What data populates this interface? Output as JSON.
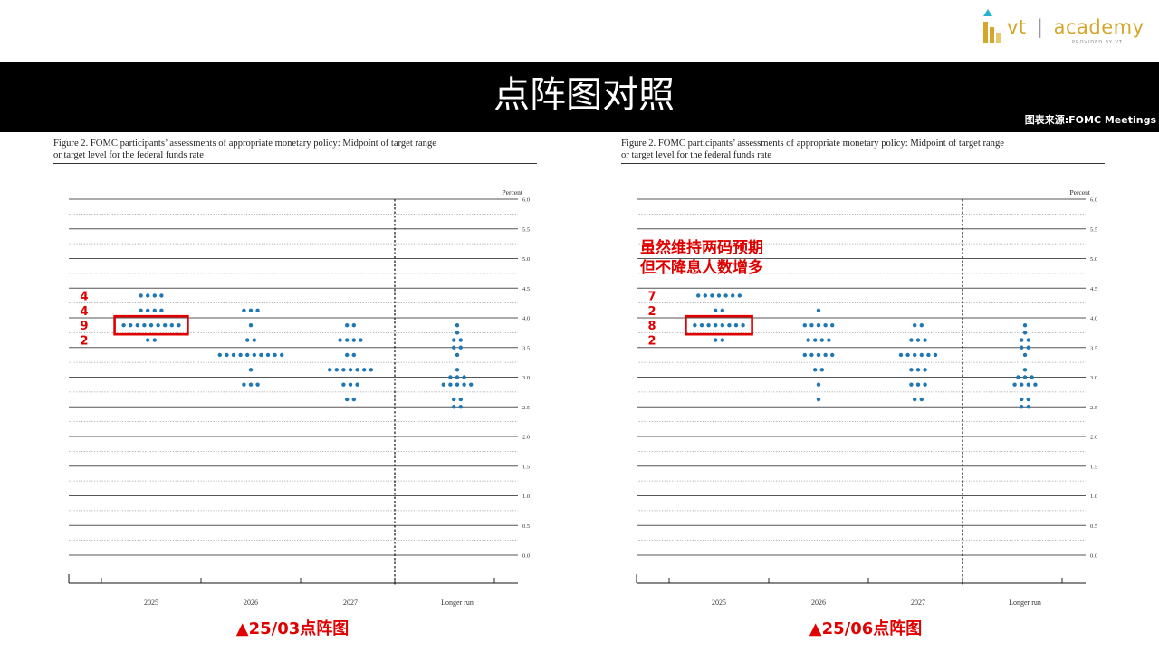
{
  "brand": {
    "name": "vt academy",
    "word_left": "vt",
    "word_right": "academy",
    "tagline": "PROVIDED BY VT",
    "colors": {
      "gold": "#d4a72c",
      "teal": "#22b5c9"
    }
  },
  "header": {
    "title": "点阵图对照",
    "source": "图表来源:FOMC Meetings"
  },
  "colors": {
    "band": "#000000",
    "dot": "#1f77b4",
    "highlight": "#e00000"
  },
  "chart_data": [
    {
      "type": "scatter",
      "panel_id": "march",
      "title": "Figure 2.  FOMC participants’ assessments of appropriate monetary policy:  Midpoint of target range",
      "title_line2": "or target level for the federal funds rate",
      "ylabel": "Percent",
      "ylim": [
        0.0,
        6.0
      ],
      "yticks": [
        "0.0",
        "0.5",
        "1.0",
        "1.5",
        "2.0",
        "2.5",
        "3.0",
        "3.5",
        "4.0",
        "4.5",
        "5.0",
        "5.5",
        "6.0"
      ],
      "categories": [
        "2025",
        "2026",
        "2027",
        "Longer run"
      ],
      "grid": true,
      "caption": "▲25/03点阵图",
      "annotations": {
        "counts": [
          {
            "label": "4",
            "y": 4.375
          },
          {
            "label": "4",
            "y": 4.125
          },
          {
            "label": "9",
            "y": 3.875
          },
          {
            "label": "2",
            "y": 3.625
          }
        ],
        "highlight_rate": 3.875,
        "note_lines": []
      },
      "series": [
        {
          "category": "2025",
          "points": [
            [
              4.375,
              4
            ],
            [
              4.125,
              4
            ],
            [
              3.875,
              9
            ],
            [
              3.625,
              2
            ]
          ]
        },
        {
          "category": "2026",
          "points": [
            [
              4.125,
              3
            ],
            [
              3.875,
              1
            ],
            [
              3.625,
              2
            ],
            [
              3.375,
              10
            ],
            [
              3.125,
              1
            ],
            [
              2.875,
              3
            ]
          ]
        },
        {
          "category": "2027",
          "points": [
            [
              3.875,
              2
            ],
            [
              3.625,
              4
            ],
            [
              3.375,
              2
            ],
            [
              3.125,
              7
            ],
            [
              2.875,
              3
            ],
            [
              2.625,
              2
            ]
          ]
        },
        {
          "category": "Longer run",
          "points": [
            [
              3.875,
              1
            ],
            [
              3.75,
              1
            ],
            [
              3.625,
              2
            ],
            [
              3.5,
              2
            ],
            [
              3.375,
              1
            ],
            [
              3.125,
              1
            ],
            [
              3.0,
              3
            ],
            [
              2.875,
              5
            ],
            [
              2.625,
              2
            ],
            [
              2.5,
              2
            ]
          ]
        }
      ]
    },
    {
      "type": "scatter",
      "panel_id": "june",
      "title": "Figure 2.  FOMC participants’ assessments of appropriate monetary policy:  Midpoint of target range",
      "title_line2": "or target level for the federal funds rate",
      "ylabel": "Percent",
      "ylim": [
        0.0,
        6.0
      ],
      "yticks": [
        "0.0",
        "0.5",
        "1.0",
        "1.5",
        "2.0",
        "2.5",
        "3.0",
        "3.5",
        "4.0",
        "4.5",
        "5.0",
        "5.5",
        "6.0"
      ],
      "categories": [
        "2025",
        "2026",
        "2027",
        "Longer run"
      ],
      "grid": true,
      "caption": "▲25/06点阵图",
      "annotations": {
        "counts": [
          {
            "label": "7",
            "y": 4.375
          },
          {
            "label": "2",
            "y": 4.125
          },
          {
            "label": "8",
            "y": 3.875
          },
          {
            "label": "2",
            "y": 3.625
          }
        ],
        "highlight_rate": 3.875,
        "note_lines": [
          "虽然维持两码预期",
          "但不降息人数增多"
        ]
      },
      "series": [
        {
          "category": "2025",
          "points": [
            [
              4.375,
              7
            ],
            [
              4.125,
              2
            ],
            [
              3.875,
              8
            ],
            [
              3.625,
              2
            ]
          ]
        },
        {
          "category": "2026",
          "points": [
            [
              4.125,
              1
            ],
            [
              3.875,
              5
            ],
            [
              3.625,
              4
            ],
            [
              3.375,
              5
            ],
            [
              3.125,
              2
            ],
            [
              2.875,
              1
            ],
            [
              2.625,
              1
            ]
          ]
        },
        {
          "category": "2027",
          "points": [
            [
              3.875,
              2
            ],
            [
              3.625,
              3
            ],
            [
              3.375,
              6
            ],
            [
              3.125,
              3
            ],
            [
              2.875,
              3
            ],
            [
              2.625,
              2
            ]
          ]
        },
        {
          "category": "Longer run",
          "points": [
            [
              3.875,
              1
            ],
            [
              3.75,
              1
            ],
            [
              3.625,
              2
            ],
            [
              3.5,
              2
            ],
            [
              3.375,
              1
            ],
            [
              3.125,
              1
            ],
            [
              3.0,
              3
            ],
            [
              2.875,
              4
            ],
            [
              2.625,
              2
            ],
            [
              2.5,
              2
            ]
          ]
        }
      ]
    }
  ]
}
